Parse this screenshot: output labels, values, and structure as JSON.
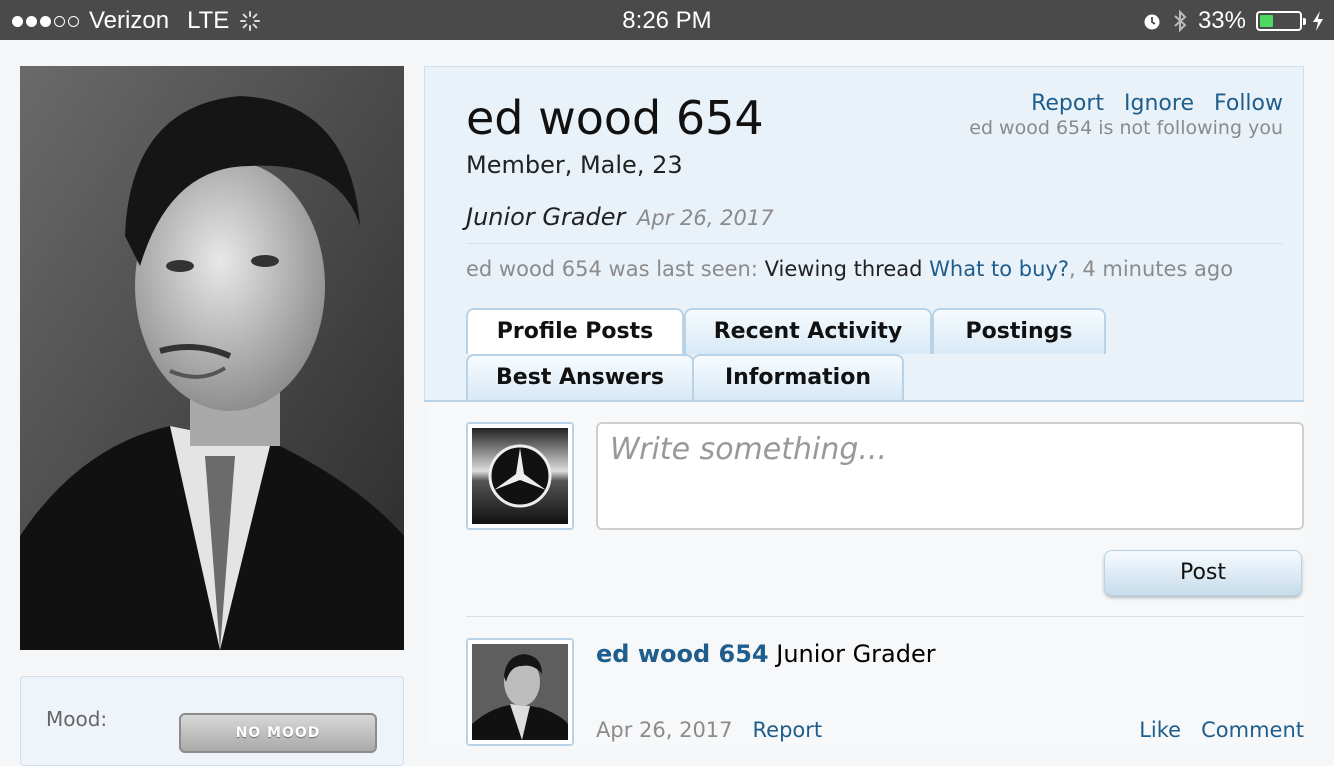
{
  "status_bar": {
    "carrier": "Verizon",
    "network": "LTE",
    "time": "8:26 PM",
    "battery": "33%",
    "battery_level": 0.33,
    "signal_bars_filled": 3,
    "signal_bars_total": 5
  },
  "sidebar": {
    "mood_label": "Mood:",
    "mood_button": "NO MOOD"
  },
  "profile": {
    "name": "ed wood 654",
    "info": "Member, Male, 23",
    "title": "Junior Grader",
    "date": "Apr 26, 2017",
    "actions": {
      "report": "Report",
      "ignore": "Ignore",
      "follow": "Follow"
    },
    "follow_note": "ed wood 654 is not following you",
    "last_seen_prefix": "ed wood 654 was last seen:",
    "last_seen_activity": "Viewing thread",
    "last_seen_thread": "What to buy?",
    "last_seen_time": ", 4 minutes ago"
  },
  "tabs": [
    "Profile Posts",
    "Recent Activity",
    "Postings",
    "Best Answers",
    "Information"
  ],
  "compose": {
    "placeholder": "Write something...",
    "post_button": "Post"
  },
  "post": {
    "author": "ed wood 654",
    "author_title": "Junior Grader",
    "date": "Apr 26, 2017",
    "report": "Report",
    "like": "Like",
    "comment": "Comment"
  },
  "colors": {
    "link": "#1e5d8c",
    "status_bar": "#4a4a4a",
    "battery_fill": "#4cd964",
    "panel": "#eaf2f9"
  }
}
